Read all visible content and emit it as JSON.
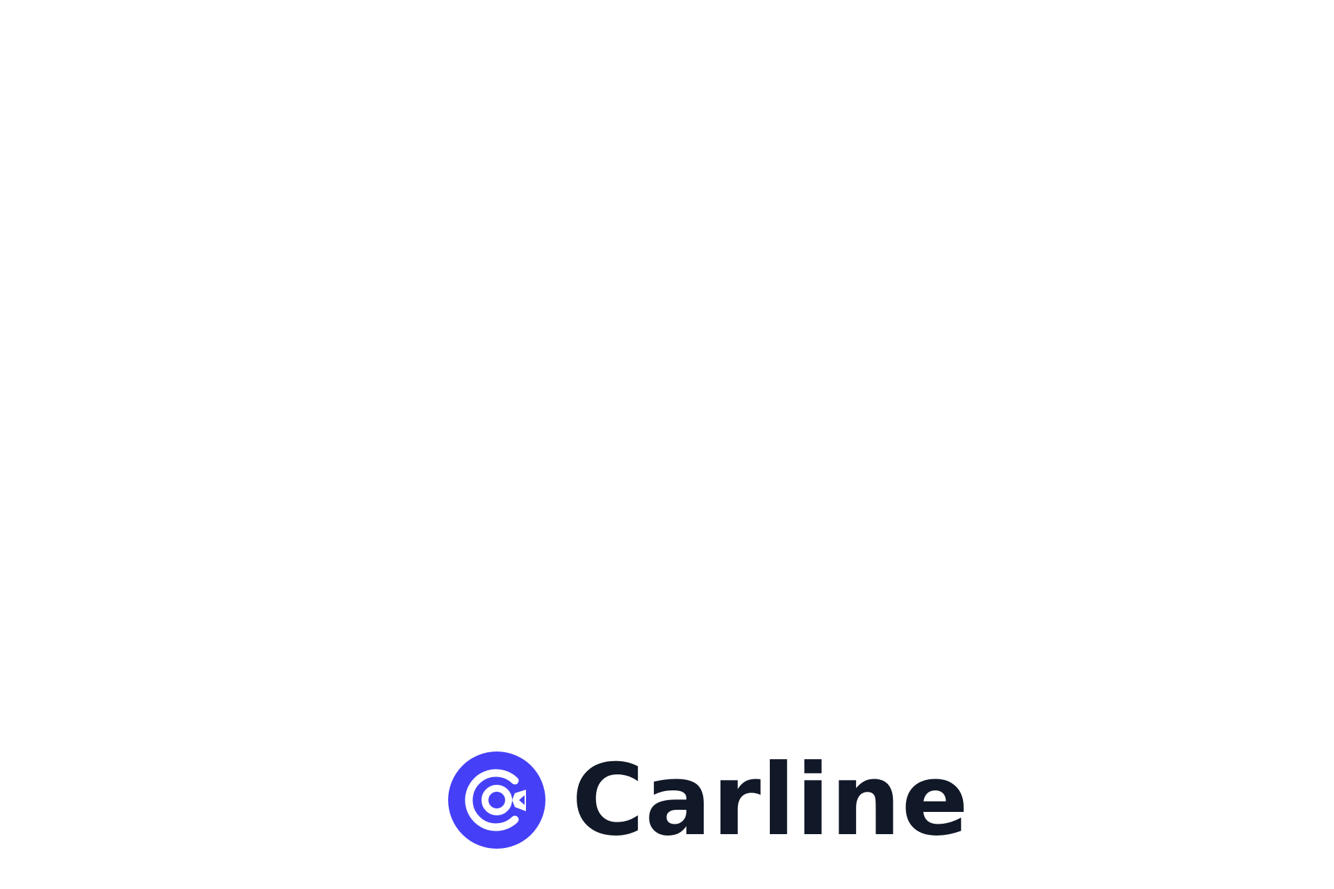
{
  "brand": {
    "name": "Carline",
    "logo_icon": "carline-logo-icon",
    "colors": {
      "accent": "#4540f7",
      "text": "#111827",
      "background": "#ffffff"
    }
  }
}
